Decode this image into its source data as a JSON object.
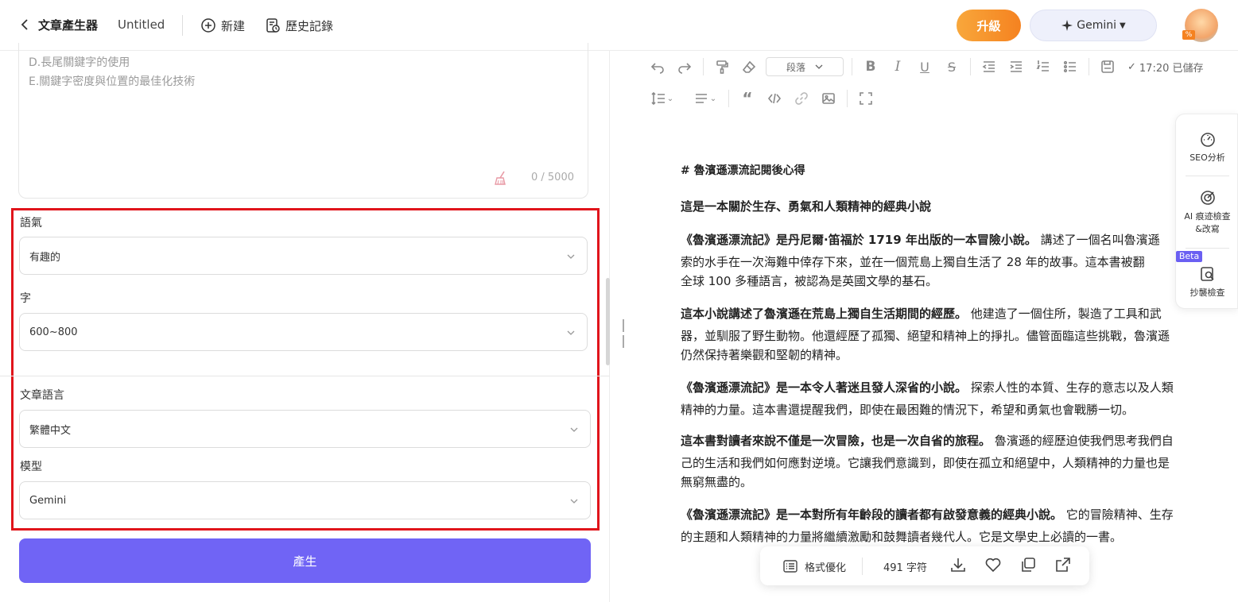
{
  "header": {
    "title": "文章產生器",
    "doc_name": "Untitled",
    "new_label": "新建",
    "history_label": "歷史記錄",
    "upgrade_label": "升級",
    "model_label": "Gemini",
    "avatar_badge": "%"
  },
  "left": {
    "outline_lines": [
      "D.長尾關鍵字的使用",
      "E.關鍵字密度與位置的最佳化技術"
    ],
    "char_count": "0 / 5000",
    "tone_label": "語氣",
    "tone_value": "有趣的",
    "words_label": "字",
    "words_value": "600~800",
    "language_label": "文章語言",
    "language_value": "繁體中文",
    "model_label": "模型",
    "model_value": "Gemini",
    "generate_label": "產生"
  },
  "toolbar": {
    "paragraph_select": "段落",
    "saved_status": "17:20 已儲存"
  },
  "document": {
    "heading": "# 魯濱遜漂流記閱後心得",
    "subheading": "這是一本關於生存、勇氣和人類精神的經典小說",
    "paragraphs": [
      {
        "bold": "《魯濱遜漂流記》是丹尼爾·笛福於 1719 年出版的一本冒險小說。",
        "line1": " 講述了一個名叫魯濱遜",
        "rest1": "索的水手在一次海難中倖存下來，並在一個荒島上獨自生活了 28 年的故事。這本書被翻",
        "rest2": "全球 100 多種語言，被認為是英國文學的基石。"
      },
      {
        "bold": "這本小說講述了魯濱遜在荒島上獨自生活期間的經歷。",
        "line1": " 他建造了一個住所，製造了工具和武",
        "rest1": "器，並馴服了野生動物。他還經歷了孤獨、絕望和精神上的掙扎。儘管面臨這些挑戰，魯濱遜",
        "rest2": "仍然保持著樂觀和堅韌的精神。"
      },
      {
        "bold": "《魯濱遜漂流記》是一本令人著迷且發人深省的小說。",
        "line1": " 探索人性的本質、生存的意志以及人類",
        "rest1": "精神的力量。這本書還提醒我們，即使在最困難的情況下，希望和勇氣也會戰勝一切。",
        "rest2": ""
      },
      {
        "bold": "這本書對讀者來說不僅是一次冒險，也是一次自省的旅程。",
        "line1": " 魯濱遜的經歷迫使我們思考我們自",
        "rest1": "己的生活和我們如何應對逆境。它讓我們意識到，即使在孤立和絕望中，人類精神的力量也是",
        "rest2": "無窮無盡的。"
      },
      {
        "bold": "《魯濱遜漂流記》是一本對所有年齡段的讀者都有啟發意義的經典小說。",
        "line1": " 它的冒險精神、生存",
        "rest1": "的主題和人類精神的力量將繼續激勵和鼓舞讀者幾代人。它是文學史上必讀的一書。",
        "rest2": ""
      }
    ]
  },
  "side_tools": {
    "seo_label": "SEO分析",
    "ai_label_1": "AI 痕迹檢查",
    "ai_label_2": "&改寫",
    "beta_label": "Beta",
    "plagiarism_label": "抄襲檢查"
  },
  "bottom_bar": {
    "format_label": "格式優化",
    "word_count": "491 字符"
  }
}
